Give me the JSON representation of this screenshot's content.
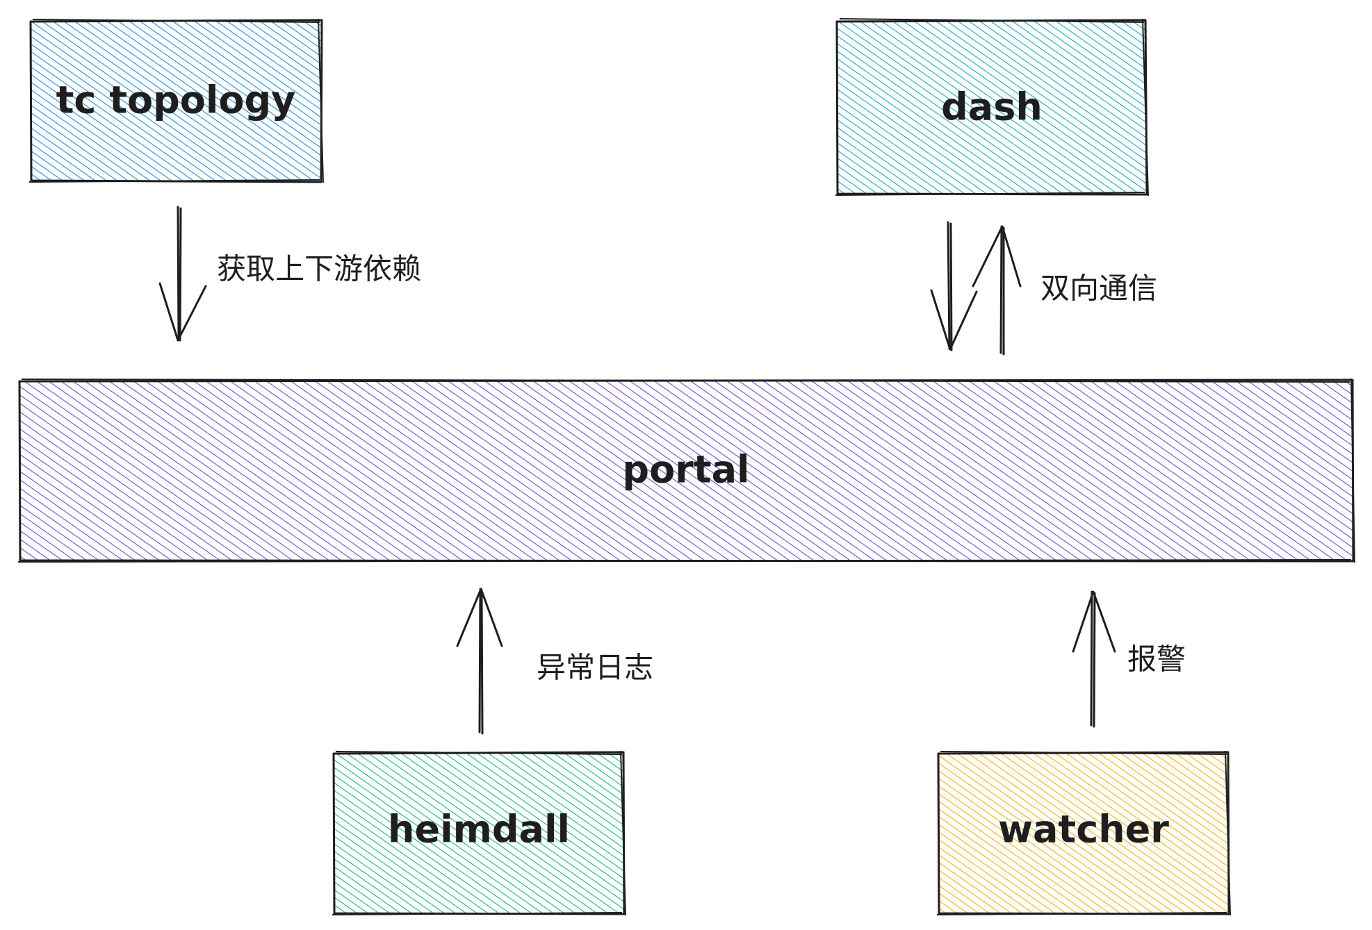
{
  "nodes": {
    "tc_topology": {
      "label": "tc topology",
      "color": "#228be6"
    },
    "dash": {
      "label": "dash",
      "color": "#15aabf"
    },
    "portal": {
      "label": "portal",
      "color": "#7048e8"
    },
    "heimdall": {
      "label": "heimdall",
      "color": "#12b886"
    },
    "watcher": {
      "label": "watcher",
      "color": "#fab005"
    }
  },
  "edges": {
    "topology_to_portal": {
      "label": "获取上下游依赖"
    },
    "dash_portal": {
      "label": "双向通信"
    },
    "heimdall_to_portal": {
      "label": "异常日志"
    },
    "watcher_to_portal": {
      "label": "报警"
    }
  }
}
